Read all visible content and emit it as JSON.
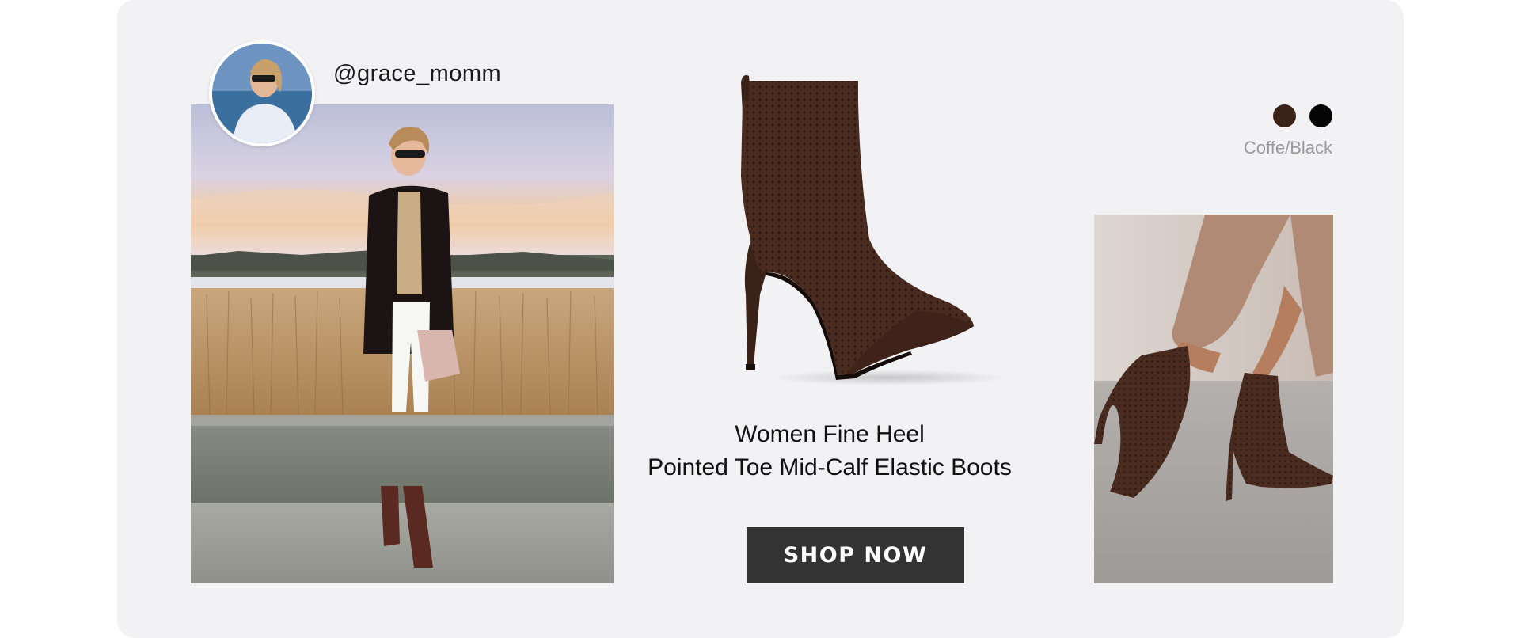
{
  "influencer": {
    "handle": "@grace_momm"
  },
  "product": {
    "title_line1": "Women Fine Heel",
    "title_line2": "Pointed Toe Mid-Calf Elastic Boots",
    "cta_label": "SHOP NOW"
  },
  "colors": {
    "label": "Coffe/Black",
    "label_color": "#9a9a9a",
    "swatches": [
      {
        "name": "coffee",
        "hex": "#3a2219"
      },
      {
        "name": "black",
        "hex": "#050505"
      }
    ]
  },
  "theme": {
    "card_background": "#f2f1f4",
    "button_background": "#333333",
    "boot_color": "#4a2b20"
  }
}
